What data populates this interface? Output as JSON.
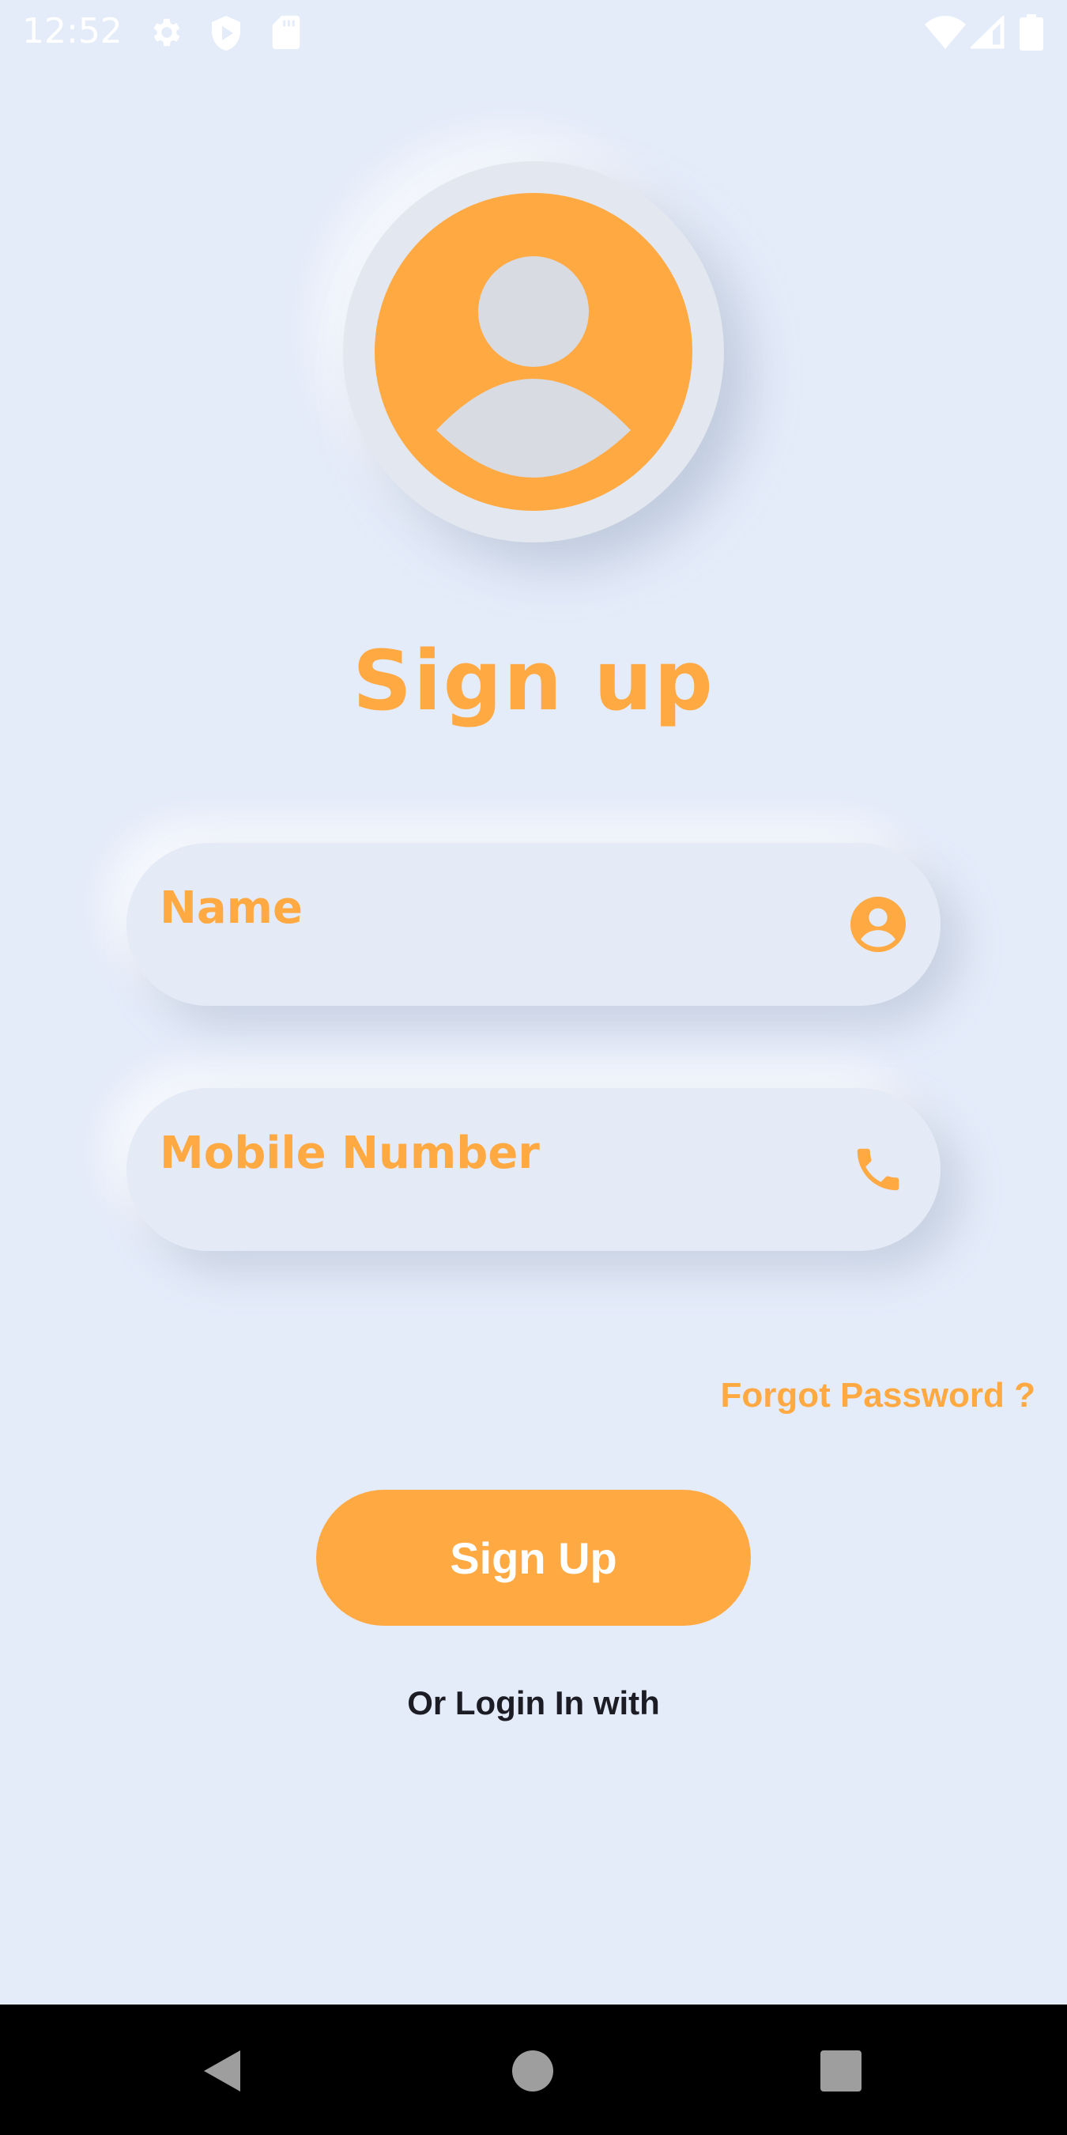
{
  "status_bar": {
    "time": "12:52",
    "icons": [
      "gear-icon",
      "shield-play-icon",
      "sd-card-icon",
      "wifi-icon",
      "signal-icon",
      "battery-icon"
    ]
  },
  "avatar": {
    "icon": "user-avatar-icon"
  },
  "title": "Sign up",
  "form": {
    "name_placeholder": "Name",
    "name_icon": "account-circle-icon",
    "mobile_placeholder": "Mobile Number",
    "mobile_icon": "phone-icon"
  },
  "forgot_password": "Forgot Password ?",
  "signup_button": "Sign Up",
  "login_with": "Or Login In with",
  "nav_bar": {
    "icons": [
      "back-icon",
      "home-icon",
      "recents-icon"
    ]
  },
  "colors": {
    "accent": "#ffa942",
    "background": "#e4ebf9",
    "avatar_silhouette": "#d8dbe2",
    "text_dark": "#1c1c24"
  }
}
